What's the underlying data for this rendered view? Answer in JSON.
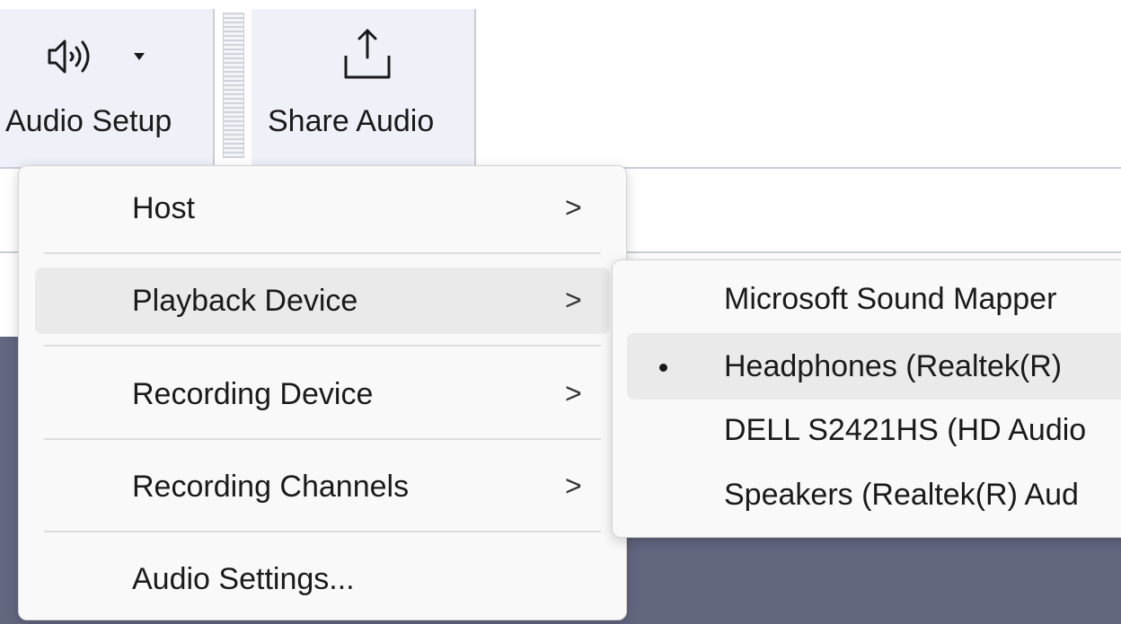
{
  "toolbar": {
    "audio_setup": {
      "label": "Audio Setup",
      "icon": "speaker-icon",
      "has_dropdown": true
    },
    "share_audio": {
      "label": "Share Audio",
      "icon": "share-upload-icon"
    }
  },
  "menu": {
    "items": [
      {
        "label": "Host",
        "submenu": true
      },
      {
        "label": "Playback Device",
        "submenu": true,
        "highlighted": true
      },
      {
        "label": "Recording Device",
        "submenu": true
      },
      {
        "label": "Recording Channels",
        "submenu": true
      },
      {
        "label": "Audio Settings...",
        "submenu": false
      }
    ],
    "chevron": ">"
  },
  "submenu": {
    "items": [
      {
        "label": "Microsoft Sound Mapper",
        "selected": false
      },
      {
        "label": "Headphones (Realtek(R)",
        "selected": true,
        "highlighted": true
      },
      {
        "label": "DELL S2421HS (HD Audio",
        "selected": false
      },
      {
        "label": "Speakers (Realtek(R) Aud",
        "selected": false
      }
    ]
  },
  "colors": {
    "toolbar_group_bg": "#eef1f8",
    "menu_bg": "#f9f9f9",
    "hover_bg": "#eaeaea",
    "dark_area": "#62667f"
  }
}
